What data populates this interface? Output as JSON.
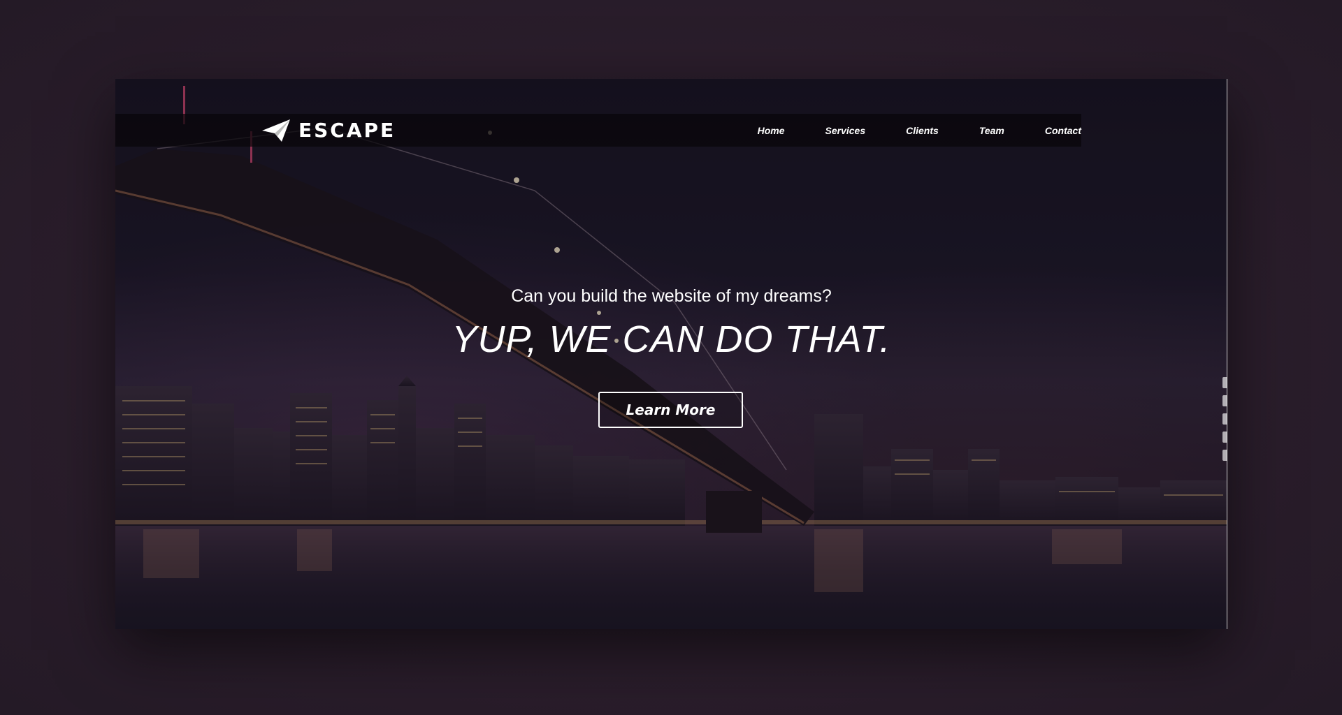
{
  "brand": {
    "name": "ESCAPE",
    "logo_icon": "paper-plane-icon"
  },
  "nav": {
    "items": [
      {
        "label": "Home"
      },
      {
        "label": "Services"
      },
      {
        "label": "Clients"
      },
      {
        "label": "Team"
      },
      {
        "label": "Contact"
      }
    ]
  },
  "hero": {
    "subtitle": "Can you build the website of my dreams?",
    "title": "YUP, WE CAN DO THAT.",
    "cta_label": "Learn More"
  },
  "side_tools": {
    "icons": [
      "pin-icon",
      "page-icon",
      "copy-icon",
      "duplicate-icon",
      "settings-icon"
    ]
  },
  "colors": {
    "text": "#ffffff",
    "navbar_bg": "#08060a",
    "page_bg": "#2a1d2b"
  }
}
